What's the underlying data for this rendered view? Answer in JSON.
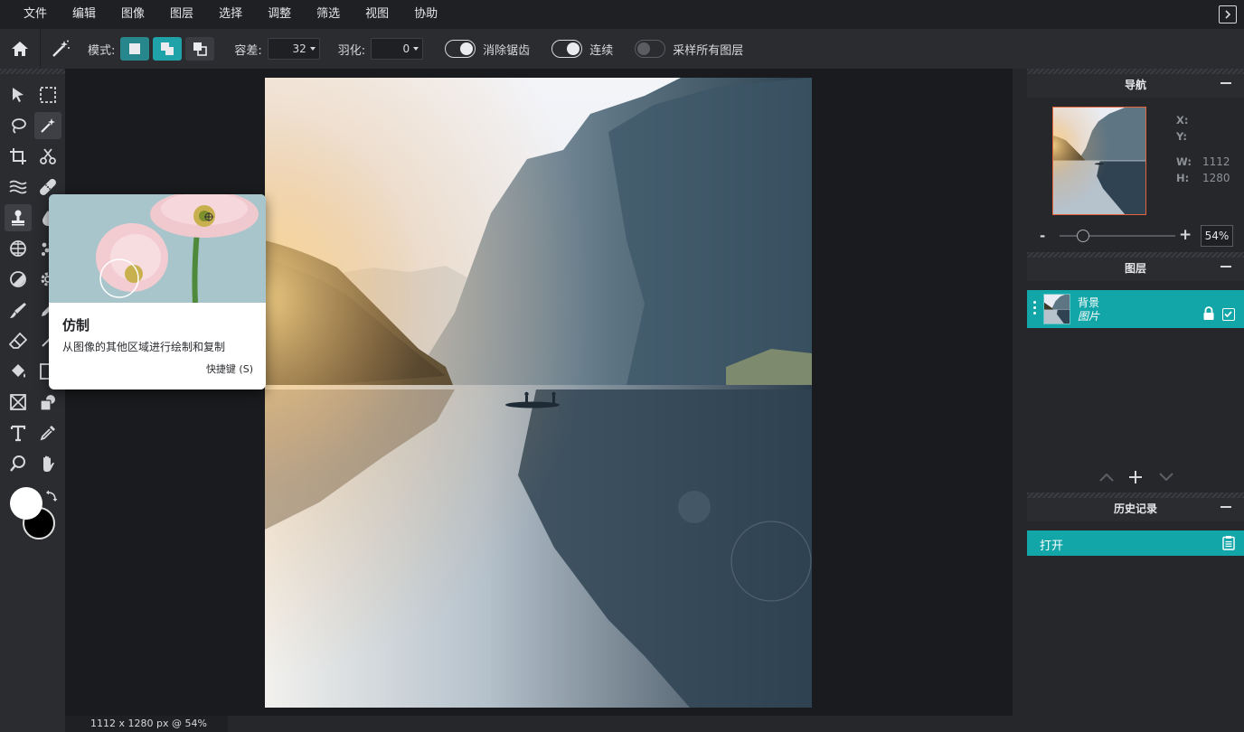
{
  "menu": {
    "items": [
      "文件",
      "编辑",
      "图像",
      "图层",
      "选择",
      "调整",
      "筛选",
      "视图",
      "协助"
    ]
  },
  "options_bar": {
    "mode_label": "模式:",
    "tolerance_label": "容差:",
    "tolerance_value": "32",
    "feather_label": "羽化:",
    "feather_value": "0",
    "antialias_label": "消除锯齿",
    "antialias_on": true,
    "contiguous_label": "连续",
    "contiguous_on": true,
    "sample_all_label": "采样所有图层",
    "sample_all_on": false
  },
  "toolbar": {
    "foreground_color": "#ffffff",
    "background_color": "#000000",
    "active_tool": "clone-stamp"
  },
  "tooltip": {
    "title": "仿制",
    "description": "从图像的其他区域进行绘制和复制",
    "shortcut": "快捷键 (S)"
  },
  "status_bar": {
    "info": "1112 x 1280 px @ 54%"
  },
  "navigator": {
    "title": "导航",
    "x_label": "X:",
    "y_label": "Y:",
    "w_label": "W:",
    "w_value": "1112",
    "h_label": "H:",
    "h_value": "1280",
    "zoom_minus": "-",
    "zoom_plus": "+",
    "zoom_value": "54%",
    "zoom_fraction": 0.2
  },
  "layers": {
    "title": "图层",
    "items": [
      {
        "name": "背景",
        "type": "图片",
        "locked": true,
        "visible": true
      }
    ]
  },
  "history": {
    "title": "历史记录",
    "items": [
      "打开"
    ]
  },
  "colors": {
    "accent": "#12a6a8",
    "mode_active": "#27878d",
    "panel_bg": "#25272a",
    "nav_border": "#e2653b"
  }
}
